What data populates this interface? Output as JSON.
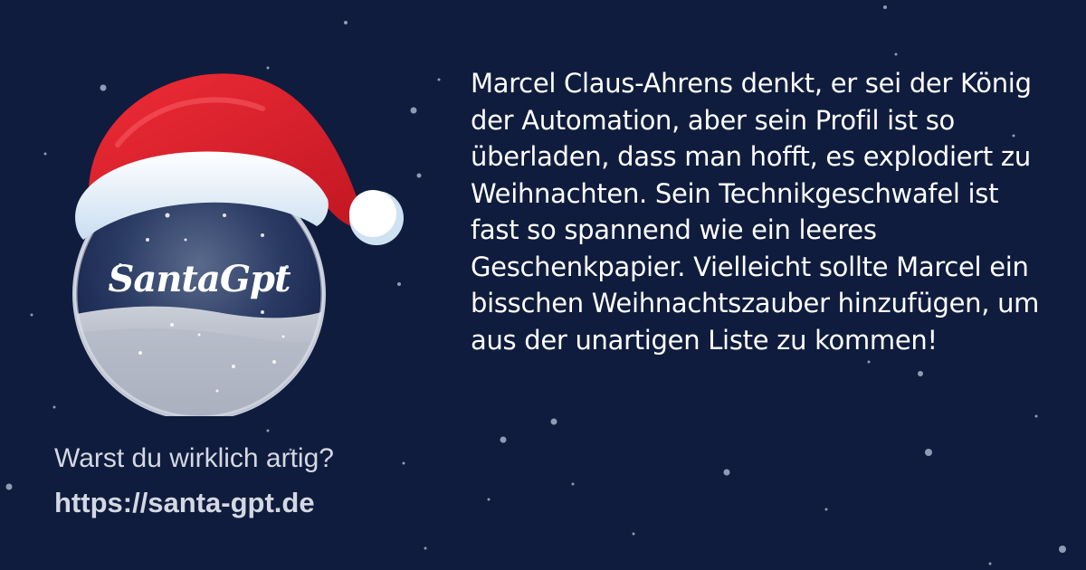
{
  "logo": {
    "text": "SantaGpt",
    "icon": "santa-hat-snow-globe-icon"
  },
  "roast_text": "Marcel Claus-Ahrens denkt, er sei der König der Automation, aber sein Profil ist so überladen, dass man hofft, es explodiert zu Weihnachten. Sein Technikgeschwafel ist fast so spannend wie ein leeres Geschenkpapier. Vielleicht sollte Marcel ein bisschen Weihnachtszauber hinzufügen, um aus der unartigen Liste zu kommen!",
  "footer": {
    "question": "Warst du wirklich artig?",
    "url": "https://santa-gpt.de"
  },
  "colors": {
    "background": "#0f1c3d",
    "hat_red": "#e0202c",
    "text": "#ffffff",
    "muted_text": "#d4d8e2"
  }
}
